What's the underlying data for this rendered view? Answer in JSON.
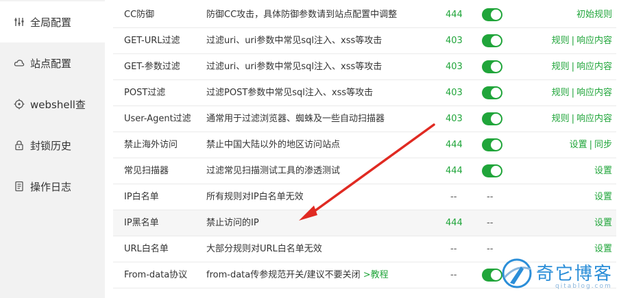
{
  "sidebar": {
    "items": [
      {
        "label": "全局配置",
        "icon": "sliders-icon",
        "active": true
      },
      {
        "label": "站点配置",
        "icon": "cloud-icon",
        "active": false
      },
      {
        "label": "webshell查",
        "icon": "target-icon",
        "active": false
      },
      {
        "label": "封锁历史",
        "icon": "lock-icon",
        "active": false
      },
      {
        "label": "操作日志",
        "icon": "document-icon",
        "active": false
      }
    ]
  },
  "rows": [
    {
      "name": "CC防御",
      "desc": "防御CC攻击，具体防御参数请到站点配置中调整",
      "code": "444",
      "toggle": true,
      "actions": [
        "初始规则"
      ]
    },
    {
      "name": "GET-URL过滤",
      "desc": "过滤uri、uri参数中常见sql注入、xss等攻击",
      "code": "403",
      "toggle": true,
      "actions": [
        "规则",
        "响应内容"
      ]
    },
    {
      "name": "GET-参数过滤",
      "desc": "过滤uri、uri参数中常见sql注入、xss等攻击",
      "code": "403",
      "toggle": true,
      "actions": [
        "规则",
        "响应内容"
      ]
    },
    {
      "name": "POST过滤",
      "desc": "过滤POST参数中常见sql注入、xss等攻击",
      "code": "403",
      "toggle": true,
      "actions": [
        "规则",
        "响应内容"
      ]
    },
    {
      "name": "User-Agent过滤",
      "desc": "通常用于过滤浏览器、蜘蛛及一些自动扫描器",
      "code": "403",
      "toggle": true,
      "actions": [
        "规则",
        "响应内容"
      ]
    },
    {
      "name": "禁止海外访问",
      "desc": "禁止中国大陆以外的地区访问站点",
      "code": "444",
      "toggle": true,
      "actions": [
        "设置",
        "同步"
      ]
    },
    {
      "name": "常见扫描器",
      "desc": "过滤常见扫描测试工具的渗透测试",
      "code": "444",
      "toggle": true,
      "actions": [
        "设置"
      ]
    },
    {
      "name": "IP白名单",
      "desc": "所有规则对IP白名单无效",
      "code": "--",
      "toggle_text": "--",
      "actions": [
        "设置"
      ]
    },
    {
      "name": "IP黑名单",
      "desc": "禁止访问的IP",
      "code": "444",
      "toggle_text": "--",
      "actions": [
        "设置"
      ],
      "highlight": true
    },
    {
      "name": "URL白名单",
      "desc": "大部分规则对URL白名单无效",
      "code": "--",
      "toggle_text": "--",
      "actions": [
        "设置"
      ]
    },
    {
      "name": "From-data协议",
      "desc": "from-data传参规范开关/建议不要关闭",
      "desc_link": ">教程",
      "code": "--",
      "toggle": true,
      "actions": []
    }
  ],
  "separator": "|",
  "watermark": {
    "title": "奇它博客",
    "sub": "qitablog.com"
  },
  "colors": {
    "accent": "#20a53a",
    "arrow": "#e02a22",
    "watermark": "#2b8ed8",
    "sidebar_bg": "#f2f2f2"
  }
}
